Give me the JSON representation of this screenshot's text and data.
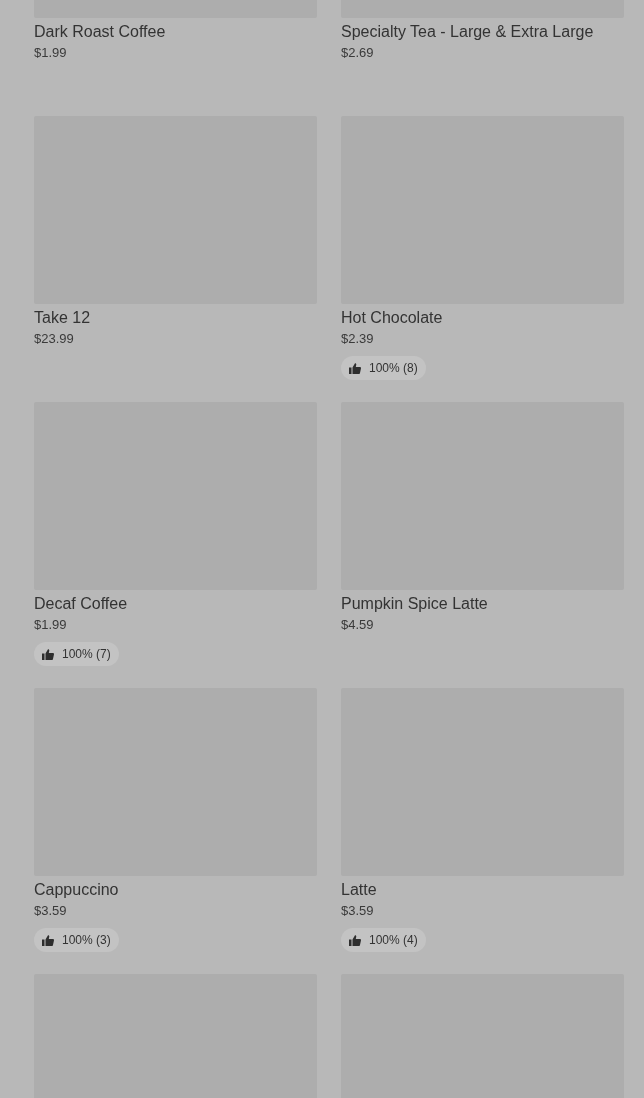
{
  "products": [
    {
      "kind": "product",
      "name": "Dark Roast Coffee",
      "price": "$1.99"
    },
    {
      "kind": "product",
      "name": "Specialty Tea - Large & Extra Large",
      "price": "$2.69"
    },
    {
      "kind": "product",
      "name": "Take 12",
      "price": "$23.99"
    },
    {
      "kind": "product",
      "name": "Hot Chocolate",
      "price": "$2.39",
      "rating": "100% (8)"
    },
    {
      "kind": "product",
      "name": "Decaf Coffee",
      "price": "$1.99",
      "rating": "100% (7)"
    },
    {
      "kind": "product",
      "name": "Pumpkin Spice Latte",
      "price": "$4.59"
    },
    {
      "kind": "product",
      "name": "Cappuccino",
      "price": "$3.59",
      "rating": "100% (3)"
    },
    {
      "kind": "product",
      "name": "Latte",
      "price": "$3.59",
      "rating": "100% (4)"
    },
    {
      "kind": "picture"
    },
    {
      "kind": "picture"
    }
  ]
}
